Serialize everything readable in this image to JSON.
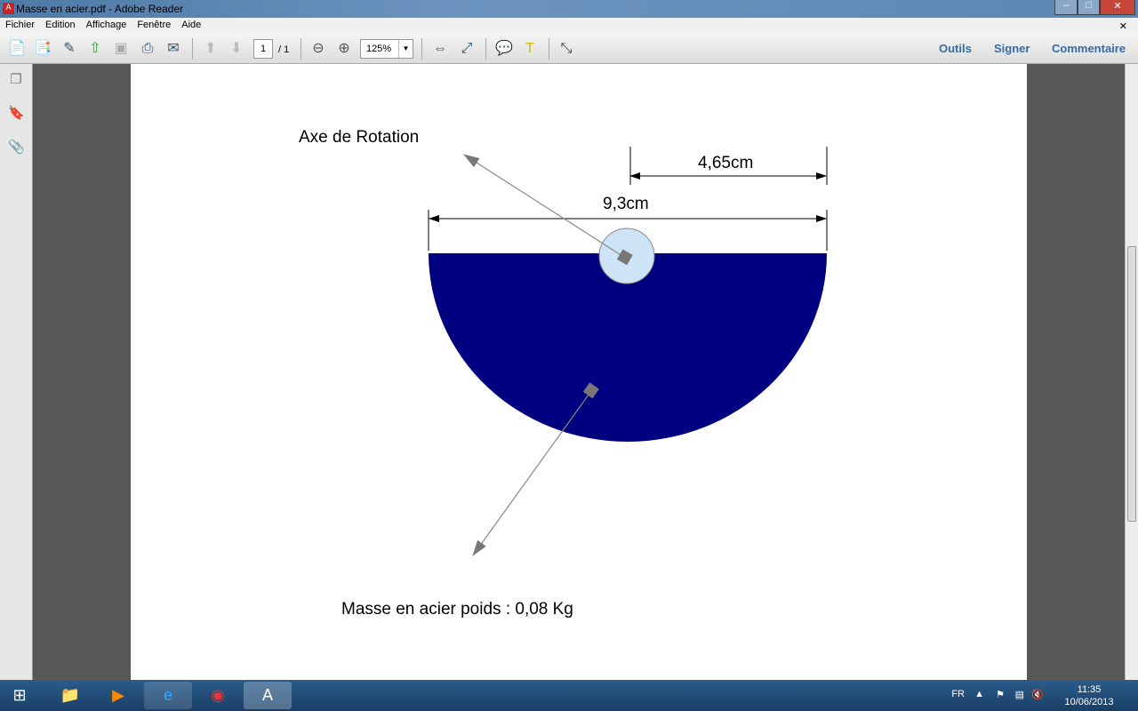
{
  "window": {
    "title": "Masse en acier.pdf - Adobe Reader",
    "app_icon": "adobe-reader-icon"
  },
  "menu": [
    "Fichier",
    "Edition",
    "Affichage",
    "Fenêtre",
    "Aide"
  ],
  "toolbar": {
    "page_current": "1",
    "page_total": "/ 1",
    "zoom": "125%",
    "right": [
      "Outils",
      "Signer",
      "Commentaire"
    ]
  },
  "document": {
    "axis_label": "Axe de Rotation",
    "radius_label": "4,65cm",
    "diameter_label": "9,3cm",
    "mass_label": "Masse en acier poids : 0,08 Kg",
    "fill_color": "#000080",
    "hub_color": "#cce4f5"
  },
  "taskbar": {
    "language": "FR",
    "time": "11:35",
    "date": "10/06/2013"
  }
}
